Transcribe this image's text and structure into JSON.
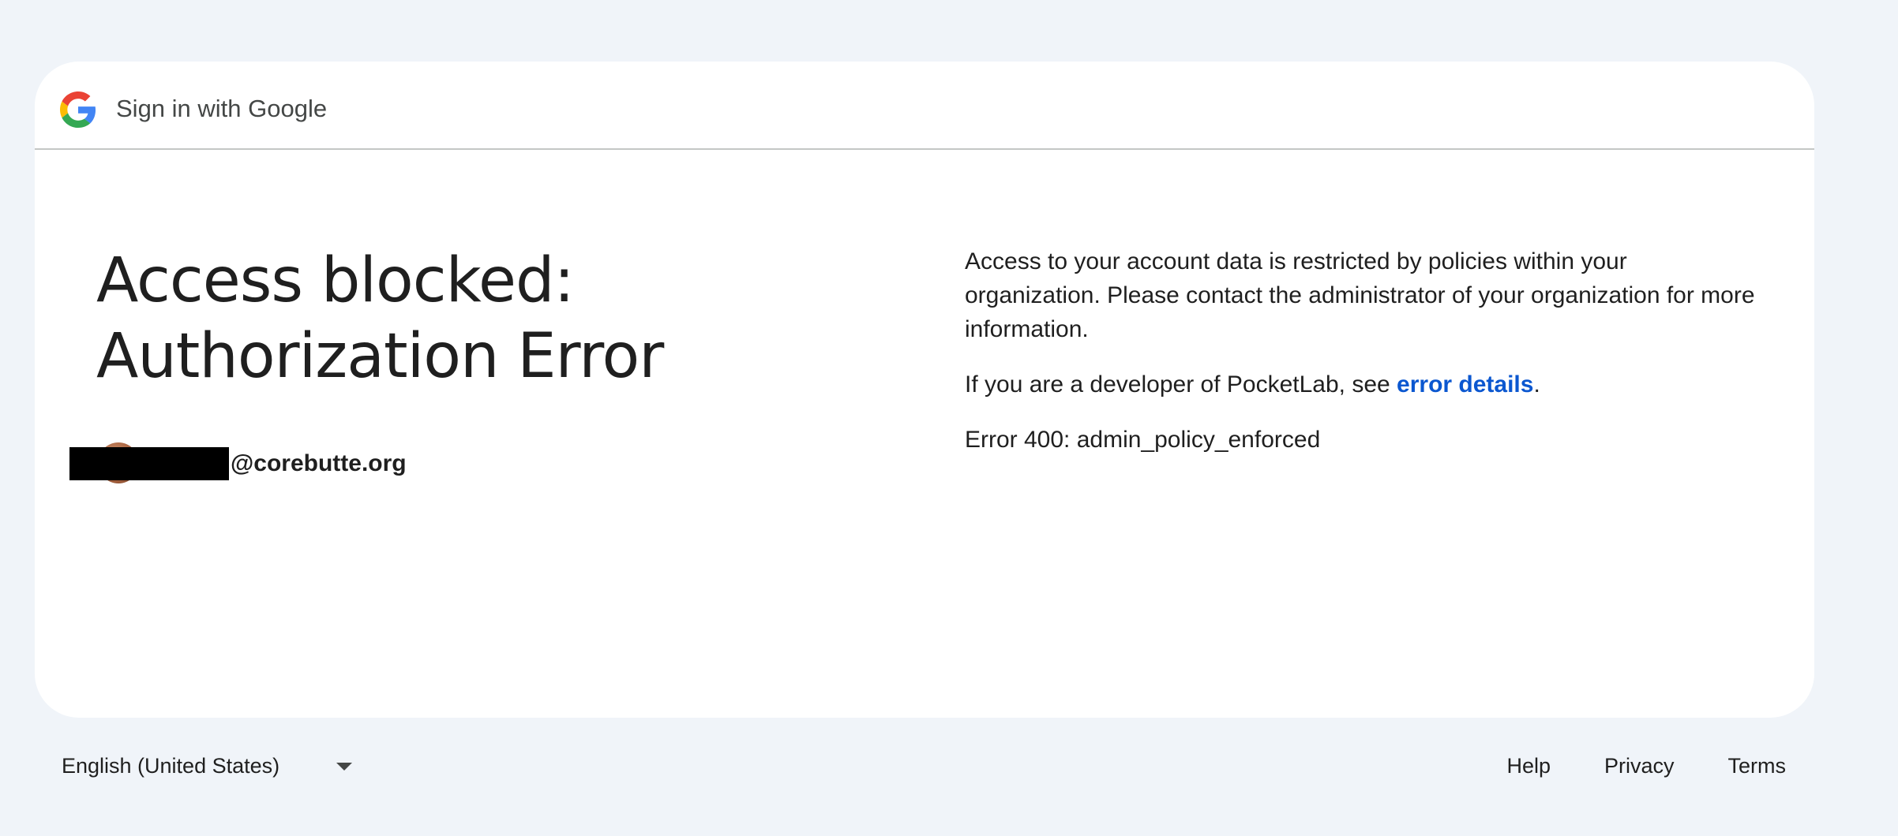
{
  "header": {
    "logo_icon": "google-g-icon",
    "title": "Sign in with Google"
  },
  "main": {
    "headline_line1": "Access blocked:",
    "headline_line2": "Authorization Error",
    "account_email": "@corebutte.org",
    "message_p1": "Access to your account data is restricted by policies within your organization. Please contact the administrator of your organization for more information.",
    "message_p2_prefix": "If you are a developer of PocketLab, see ",
    "message_p2_link": "error details",
    "message_p2_suffix": ".",
    "error_code": "Error 400: admin_policy_enforced"
  },
  "footer": {
    "language": "English (United States)",
    "links": [
      "Help",
      "Privacy",
      "Terms"
    ]
  },
  "colors": {
    "background": "#f0f4f9",
    "card": "#ffffff",
    "link": "#0b57d0",
    "text": "#1f1f1f"
  }
}
